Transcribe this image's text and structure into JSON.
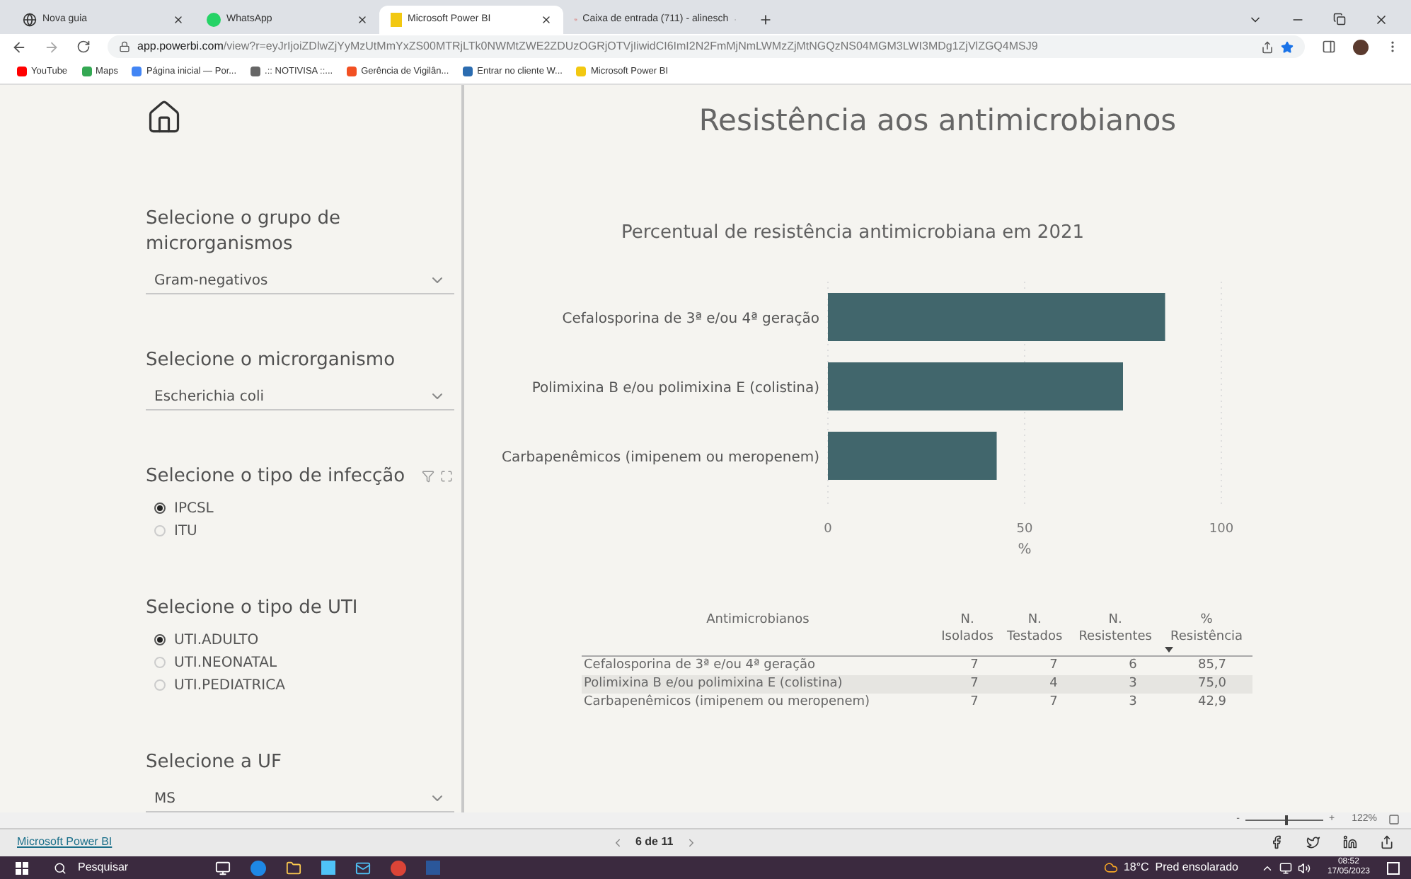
{
  "browser": {
    "tabs": [
      {
        "title": "Nova guia",
        "selected": false
      },
      {
        "title": "WhatsApp",
        "selected": false
      },
      {
        "title": "Microsoft Power BI",
        "selected": true
      },
      {
        "title": "Caixa de entrada (711) - alinesch",
        "selected": false
      }
    ],
    "url_host": "app.powerbi.com",
    "url_path": "/view?r=eyJrIjoiZDlwZjYyMzUtMmYxZS00MTRjLTk0NWMtZWE2ZDUzOGRjOTVjIiwidCI6ImI2N2FmMjNmLWMzZjMtNGQzNS04MGM3LWI3MDg1ZjVlZGQ4MSJ9",
    "bookmarks": [
      "YouTube",
      "Maps",
      "Página inicial — Por...",
      ".:: NOTIVISA ::...",
      "Gerência de Vigilân...",
      "Entrar no cliente W...",
      "Microsoft Power BI"
    ]
  },
  "report": {
    "title": "Resistência aos antimicrobianos",
    "filters": [
      {
        "kind": "dropdown",
        "label": "Selecione o grupo de microrganismos",
        "value": "Gram-negativos"
      },
      {
        "kind": "dropdown",
        "label": "Selecione o microrganismo",
        "value": "Escherichia coli"
      },
      {
        "kind": "radio",
        "label": "Selecione o tipo de infecção",
        "options": [
          {
            "label": "IPCSL",
            "selected": true
          },
          {
            "label": "ITU",
            "selected": false
          }
        ]
      },
      {
        "kind": "radio",
        "label": "Selecione o tipo de UTI",
        "options": [
          {
            "label": "UTI.ADULTO",
            "selected": true
          },
          {
            "label": "UTI.NEONATAL",
            "selected": false
          },
          {
            "label": "UTI.PEDIATRICA",
            "selected": false
          }
        ]
      },
      {
        "kind": "dropdown",
        "label": "Selecione a UF",
        "value": "MS"
      }
    ],
    "chart_data": {
      "type": "bar",
      "orientation": "horizontal",
      "title": "Percentual de resistência antimicrobiana em 2021",
      "xlabel": "%",
      "categories": [
        "Cefalosporina de 3ª e/ou 4ª geração",
        "Polimixina B e/ou polimixina E (colistina)",
        "Carbapenêmicos (imipenem ou meropenem)"
      ],
      "series": [
        {
          "color": "#41666c",
          "values": [
            85.7,
            75.0,
            42.9
          ]
        }
      ],
      "xlim": [
        0,
        100
      ],
      "xticks": [
        0,
        50,
        100
      ]
    },
    "table": {
      "columns": [
        "Antimicrobianos",
        "N.\nIsolados",
        "N.\nTestados",
        "N.\nResistentes",
        "%\nResistência"
      ],
      "rows": [
        [
          "Cefalosporina de 3ª e/ou 4ª geração",
          "7",
          "7",
          "6",
          "85,7"
        ],
        [
          "Polimixina B e/ou polimixina E (colistina)",
          "7",
          "4",
          "3",
          "75,0"
        ],
        [
          "Carbapenêmicos (imipenem ou meropenem)",
          "7",
          "7",
          "3",
          "42,9"
        ]
      ]
    }
  },
  "zoom": {
    "minus": "-",
    "plus": "+",
    "level": 0.5,
    "reading": "122%"
  },
  "footer": {
    "link": "Microsoft Power BI",
    "page": "6 de 11"
  },
  "taskbar": {
    "search": "Pesquisar",
    "weather": "18°C  Pred ensolarado",
    "time": "08:52",
    "date": "17/05/2023"
  }
}
